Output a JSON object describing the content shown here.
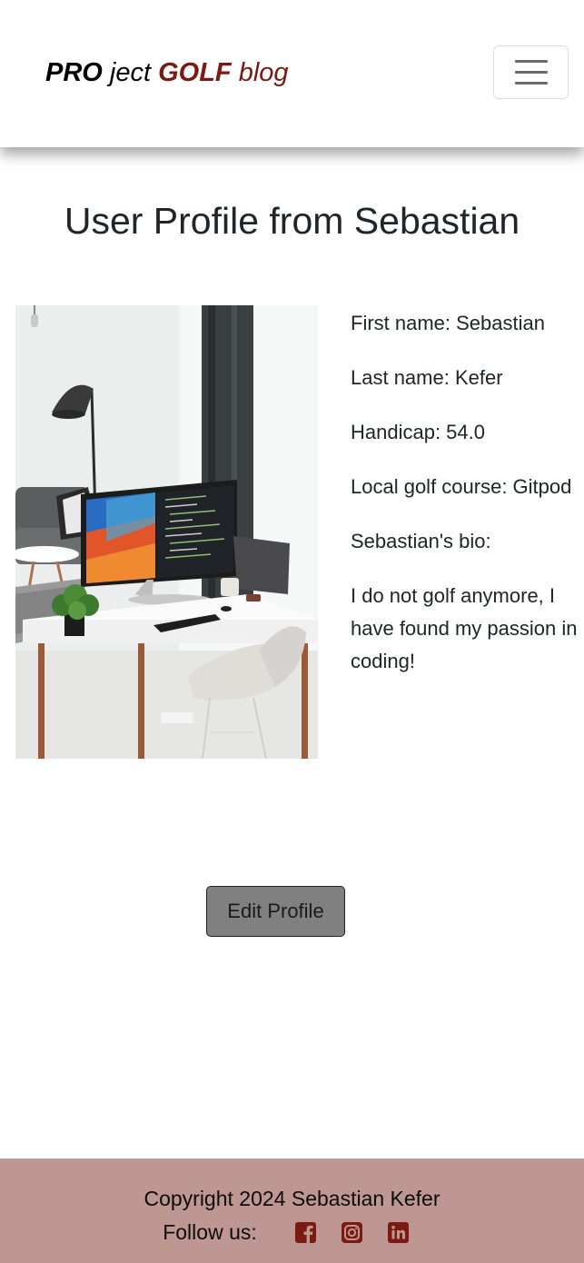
{
  "colors": {
    "brand_accent": "#7a1a10",
    "footer_bg": "#be9692",
    "button_bg": "#808080",
    "social_icon": "#7a1a10"
  },
  "navbar": {
    "brand": {
      "part1": "PRO",
      "part2": " ject ",
      "part3": "GOLF",
      "part4": " blog"
    },
    "toggler_icon": "hamburger-menu-icon"
  },
  "main": {
    "title": "User Profile from Sebastian",
    "photo_icon": "profile-photo",
    "details": {
      "first_name": "First name: Sebastian",
      "last_name": "Last name: Kefer",
      "handicap": "Handicap: 54.0",
      "local_course": "Local golf course: Gitpod",
      "bio_label": "Sebastian's bio:",
      "bio_text": "I do not golf anymore, I have found my passion in coding!"
    },
    "edit_button": "Edit Profile"
  },
  "footer": {
    "copyright": "Copyright 2024 Sebastian Kefer",
    "follow_label": "Follow us:",
    "social": [
      {
        "icon": "facebook-icon"
      },
      {
        "icon": "instagram-icon"
      },
      {
        "icon": "linkedin-icon"
      }
    ]
  }
}
